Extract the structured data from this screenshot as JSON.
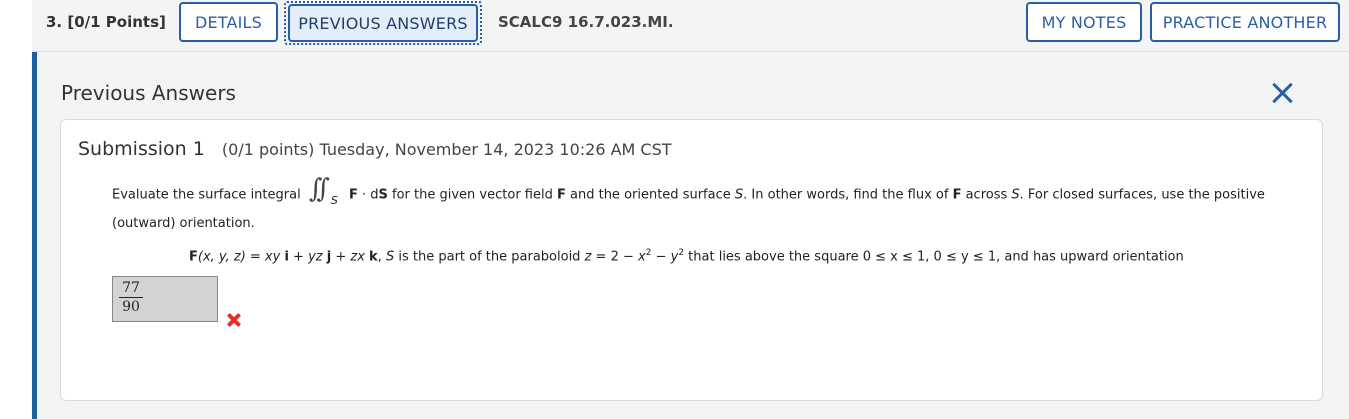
{
  "header": {
    "question_number": "3.",
    "points": "[0/1 Points]",
    "details_label": "DETAILS",
    "previous_answers_label": "PREVIOUS ANSWERS",
    "source": "SCALC9 16.7.023.MI.",
    "my_notes_label": "MY NOTES",
    "practice_another_label": "PRACTICE ANOTHER"
  },
  "panel": {
    "title": "Previous Answers"
  },
  "submission": {
    "title": "Submission 1",
    "meta": "(0/1 points) Tuesday, November 14, 2023 10:26 AM CST"
  },
  "question": {
    "intro": "Evaluate the surface integral",
    "integral_subscript": "S",
    "after_integral_1": "F",
    "after_integral_2": " · d",
    "after_integral_3": "S",
    "rest_1": " for the given vector field ",
    "rest_F": "F",
    "rest_2": " and the oriented surface ",
    "rest_S": "S",
    "rest_3": ". In other words, find the flux of ",
    "rest_F2": "F",
    "rest_4": " across ",
    "rest_S2": "S",
    "rest_5": ". For closed surfaces, use the positive",
    "line2": "(outward) orientation.",
    "field": {
      "F": "F",
      "args": "(x, y, z) = xy",
      "i": "i",
      "plus1": " + yz",
      "j": "j",
      "plus2": " + zx",
      "k": "k",
      "comma": ", ",
      "S": "S",
      "desc": " is the part of the paraboloid ",
      "z": "z",
      "eq": " = 2 − ",
      "x": "x",
      "exp1": "2",
      "minus": " − ",
      "y": "y",
      "exp2": "2",
      "tail": " that lies above the square 0 ≤ x ≤ 1, 0 ≤ y ≤ 1, and has upward orientation"
    }
  },
  "answer": {
    "numerator": "77",
    "denominator": "90",
    "status_icon": "wrong-x-icon",
    "status_color": "#e0332a"
  },
  "colors": {
    "accent": "#2a5fa5",
    "panel_border": "#1f5f9e"
  }
}
